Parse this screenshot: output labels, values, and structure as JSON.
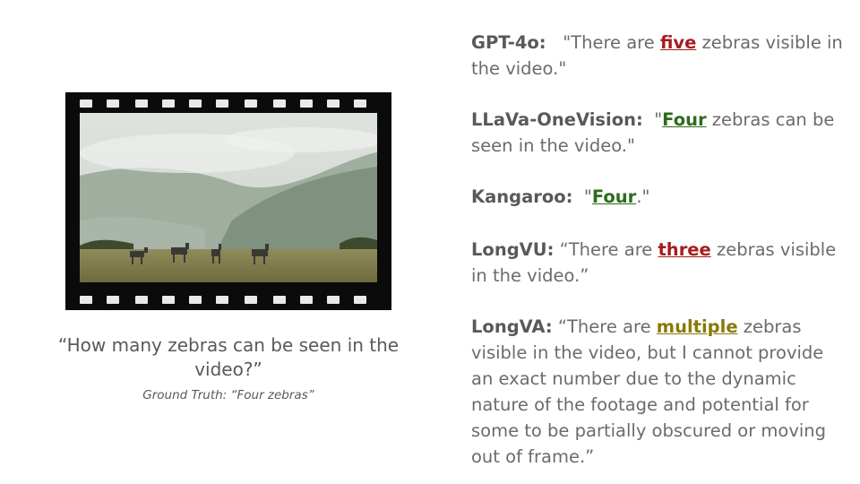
{
  "question": "“How many zebras can be seen in the video?”",
  "ground_truth": "Ground Truth: “Four zebras”",
  "responses": [
    {
      "model": "GPT-4o:",
      "pre": "\"There are ",
      "highlight": "five",
      "post": " zebras visible in the video.\"",
      "color": "#a61c1c"
    },
    {
      "model": "LLaVa-OneVision:",
      "pre": "\"",
      "highlight": "Four",
      "post": " zebras can be seen in the video.\"",
      "color": "#2f6b1d"
    },
    {
      "model": "Kangaroo:",
      "pre": "\"",
      "highlight": "Four",
      "post": ".\"",
      "color": "#2f6b1d"
    },
    {
      "model": "LongVU:",
      "pre": "“There are ",
      "highlight": "three",
      "post": " zebras visible in the video.”",
      "color": "#a61c1c"
    },
    {
      "model": "LongVA:",
      "pre": "“There are ",
      "highlight": "multiple",
      "post": " zebras visible in the video, but I cannot provide an exact number due to the dynamic nature of the footage and potential for some to be partially obscured or moving out of frame.”",
      "color": "#8a7a0a"
    }
  ]
}
